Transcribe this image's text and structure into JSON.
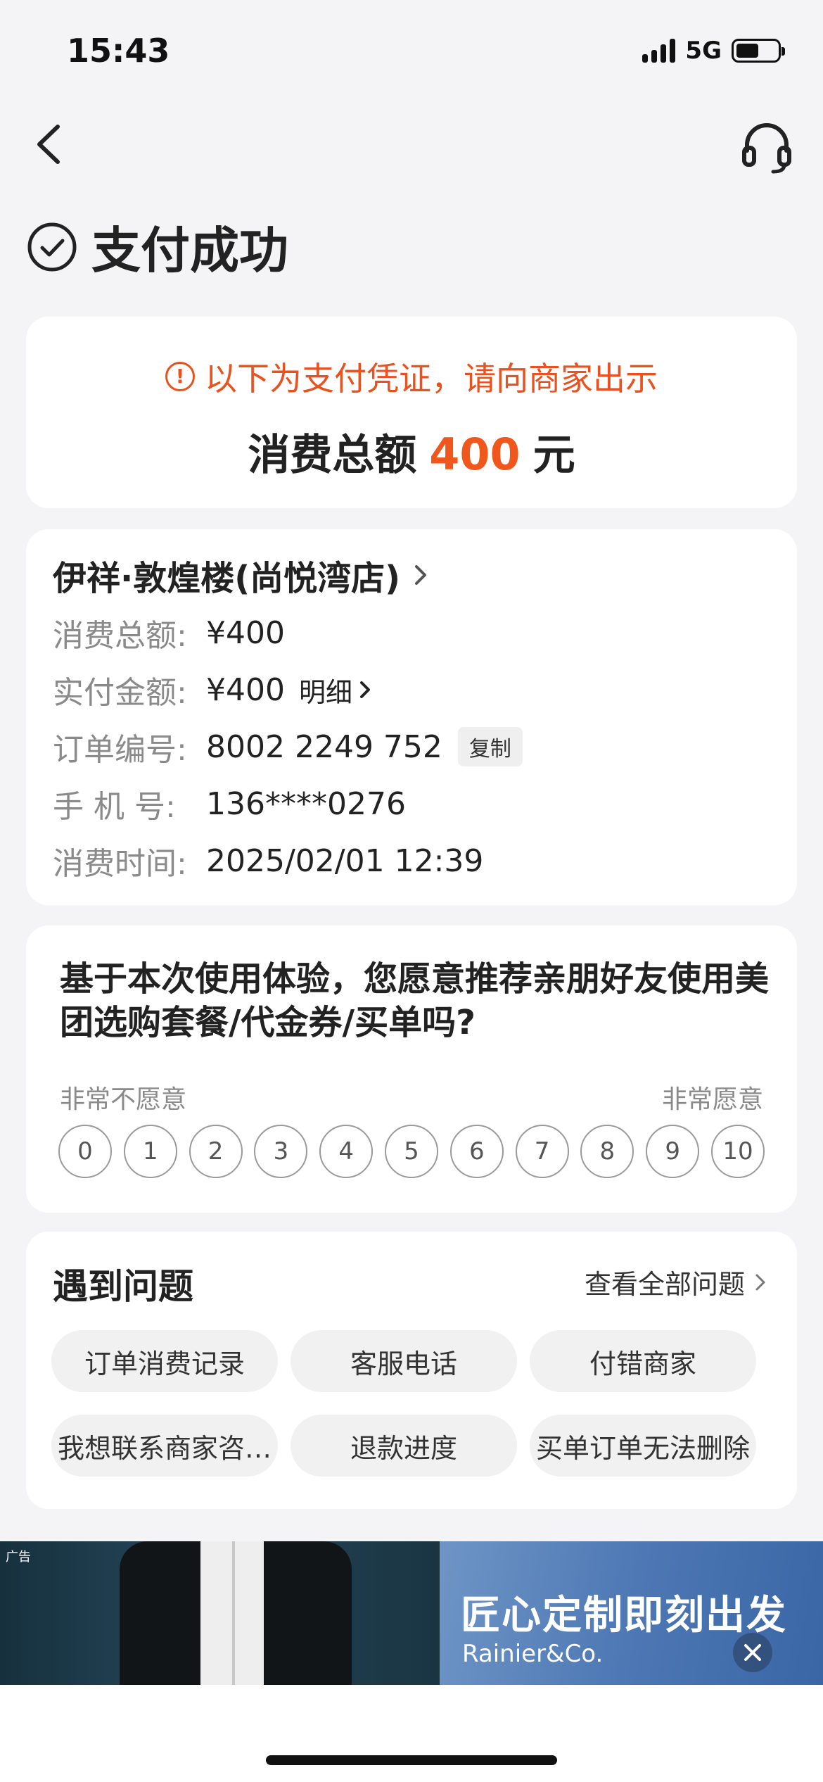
{
  "status_bar": {
    "time": "15:43",
    "network": "5G"
  },
  "page": {
    "title": "支付成功"
  },
  "voucher": {
    "note": "以下为支付凭证，请向商家出示",
    "total_prefix": "消费总额",
    "total_amount": "400",
    "total_unit": "元"
  },
  "order": {
    "shop_name": "伊祥·敦煌楼(尚悦湾店)",
    "rows": {
      "total": {
        "label": "消费总额:",
        "value": "¥400"
      },
      "paid": {
        "label": "实付金额:",
        "value": "¥400",
        "detail": "明细"
      },
      "order_no": {
        "label": "订单编号:",
        "value": "8002 2249 752",
        "copy": "复制"
      },
      "phone": {
        "label": "手 机 号:",
        "value": "136****0276"
      },
      "time": {
        "label": "消费时间:",
        "value": "2025/02/01 12:39"
      }
    }
  },
  "survey": {
    "question": "基于本次使用体验，您愿意推荐亲朋好友使用美团选购套餐/代金券/买单吗?",
    "low_label": "非常不愿意",
    "high_label": "非常愿意",
    "scores": [
      "0",
      "1",
      "2",
      "3",
      "4",
      "5",
      "6",
      "7",
      "8",
      "9",
      "10"
    ]
  },
  "help": {
    "title": "遇到问题",
    "view_all": "查看全部问题",
    "items": [
      "订单消费记录",
      "客服电话",
      "付错商家",
      "我想联系商家咨…",
      "退款进度",
      "买单订单无法删除"
    ]
  },
  "ad": {
    "tag": "广告",
    "headline": "匠心定制即刻出发",
    "brand": "Rainier&Co."
  },
  "colors": {
    "accent": "#f0571d",
    "warning": "#e9511f",
    "background": "#f4f4f6"
  },
  "icons": {
    "back": "chevron-left-icon",
    "service": "headset-icon",
    "success": "check-circle-icon",
    "warning": "exclamation-circle-icon",
    "close": "close-icon"
  }
}
